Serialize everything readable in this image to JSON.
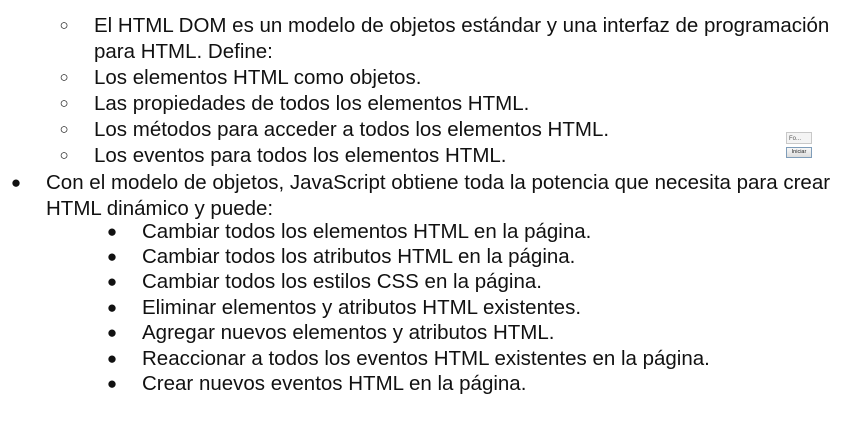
{
  "sub_list_top": {
    "items": [
      {
        "line1": "El HTML DOM es un modelo de objetos estándar y una interfaz de programación",
        "line2": "para HTML. Define:"
      },
      {
        "line1": "Los elementos HTML como objetos."
      },
      {
        "line1": "Las propiedades de todos los elementos HTML."
      },
      {
        "line1": "Los métodos para acceder a todos los elementos HTML."
      },
      {
        "line1": "Los eventos para todos los elementos HTML."
      }
    ]
  },
  "main_bullet": {
    "line1": "Con el modelo de objetos, JavaScript obtiene toda la potencia que necesita para crear",
    "line2": "HTML dinámico y puede:"
  },
  "sub_list_bottom": {
    "items": [
      "Cambiar todos los elementos HTML en la página.",
      "Cambiar todos los atributos HTML en la página.",
      "Cambiar todos los estilos CSS en la página.",
      "Eliminar elementos y atributos HTML existentes.",
      "Agregar nuevos elementos y atributos HTML.",
      "Reaccionar a todos los eventos HTML existentes en la página.",
      "Crear nuevos eventos HTML en la página."
    ]
  },
  "widget": {
    "input_value": "Fo...",
    "button_label": "Iniciar"
  },
  "bullets": {
    "hollow": "○",
    "solid": "●"
  }
}
